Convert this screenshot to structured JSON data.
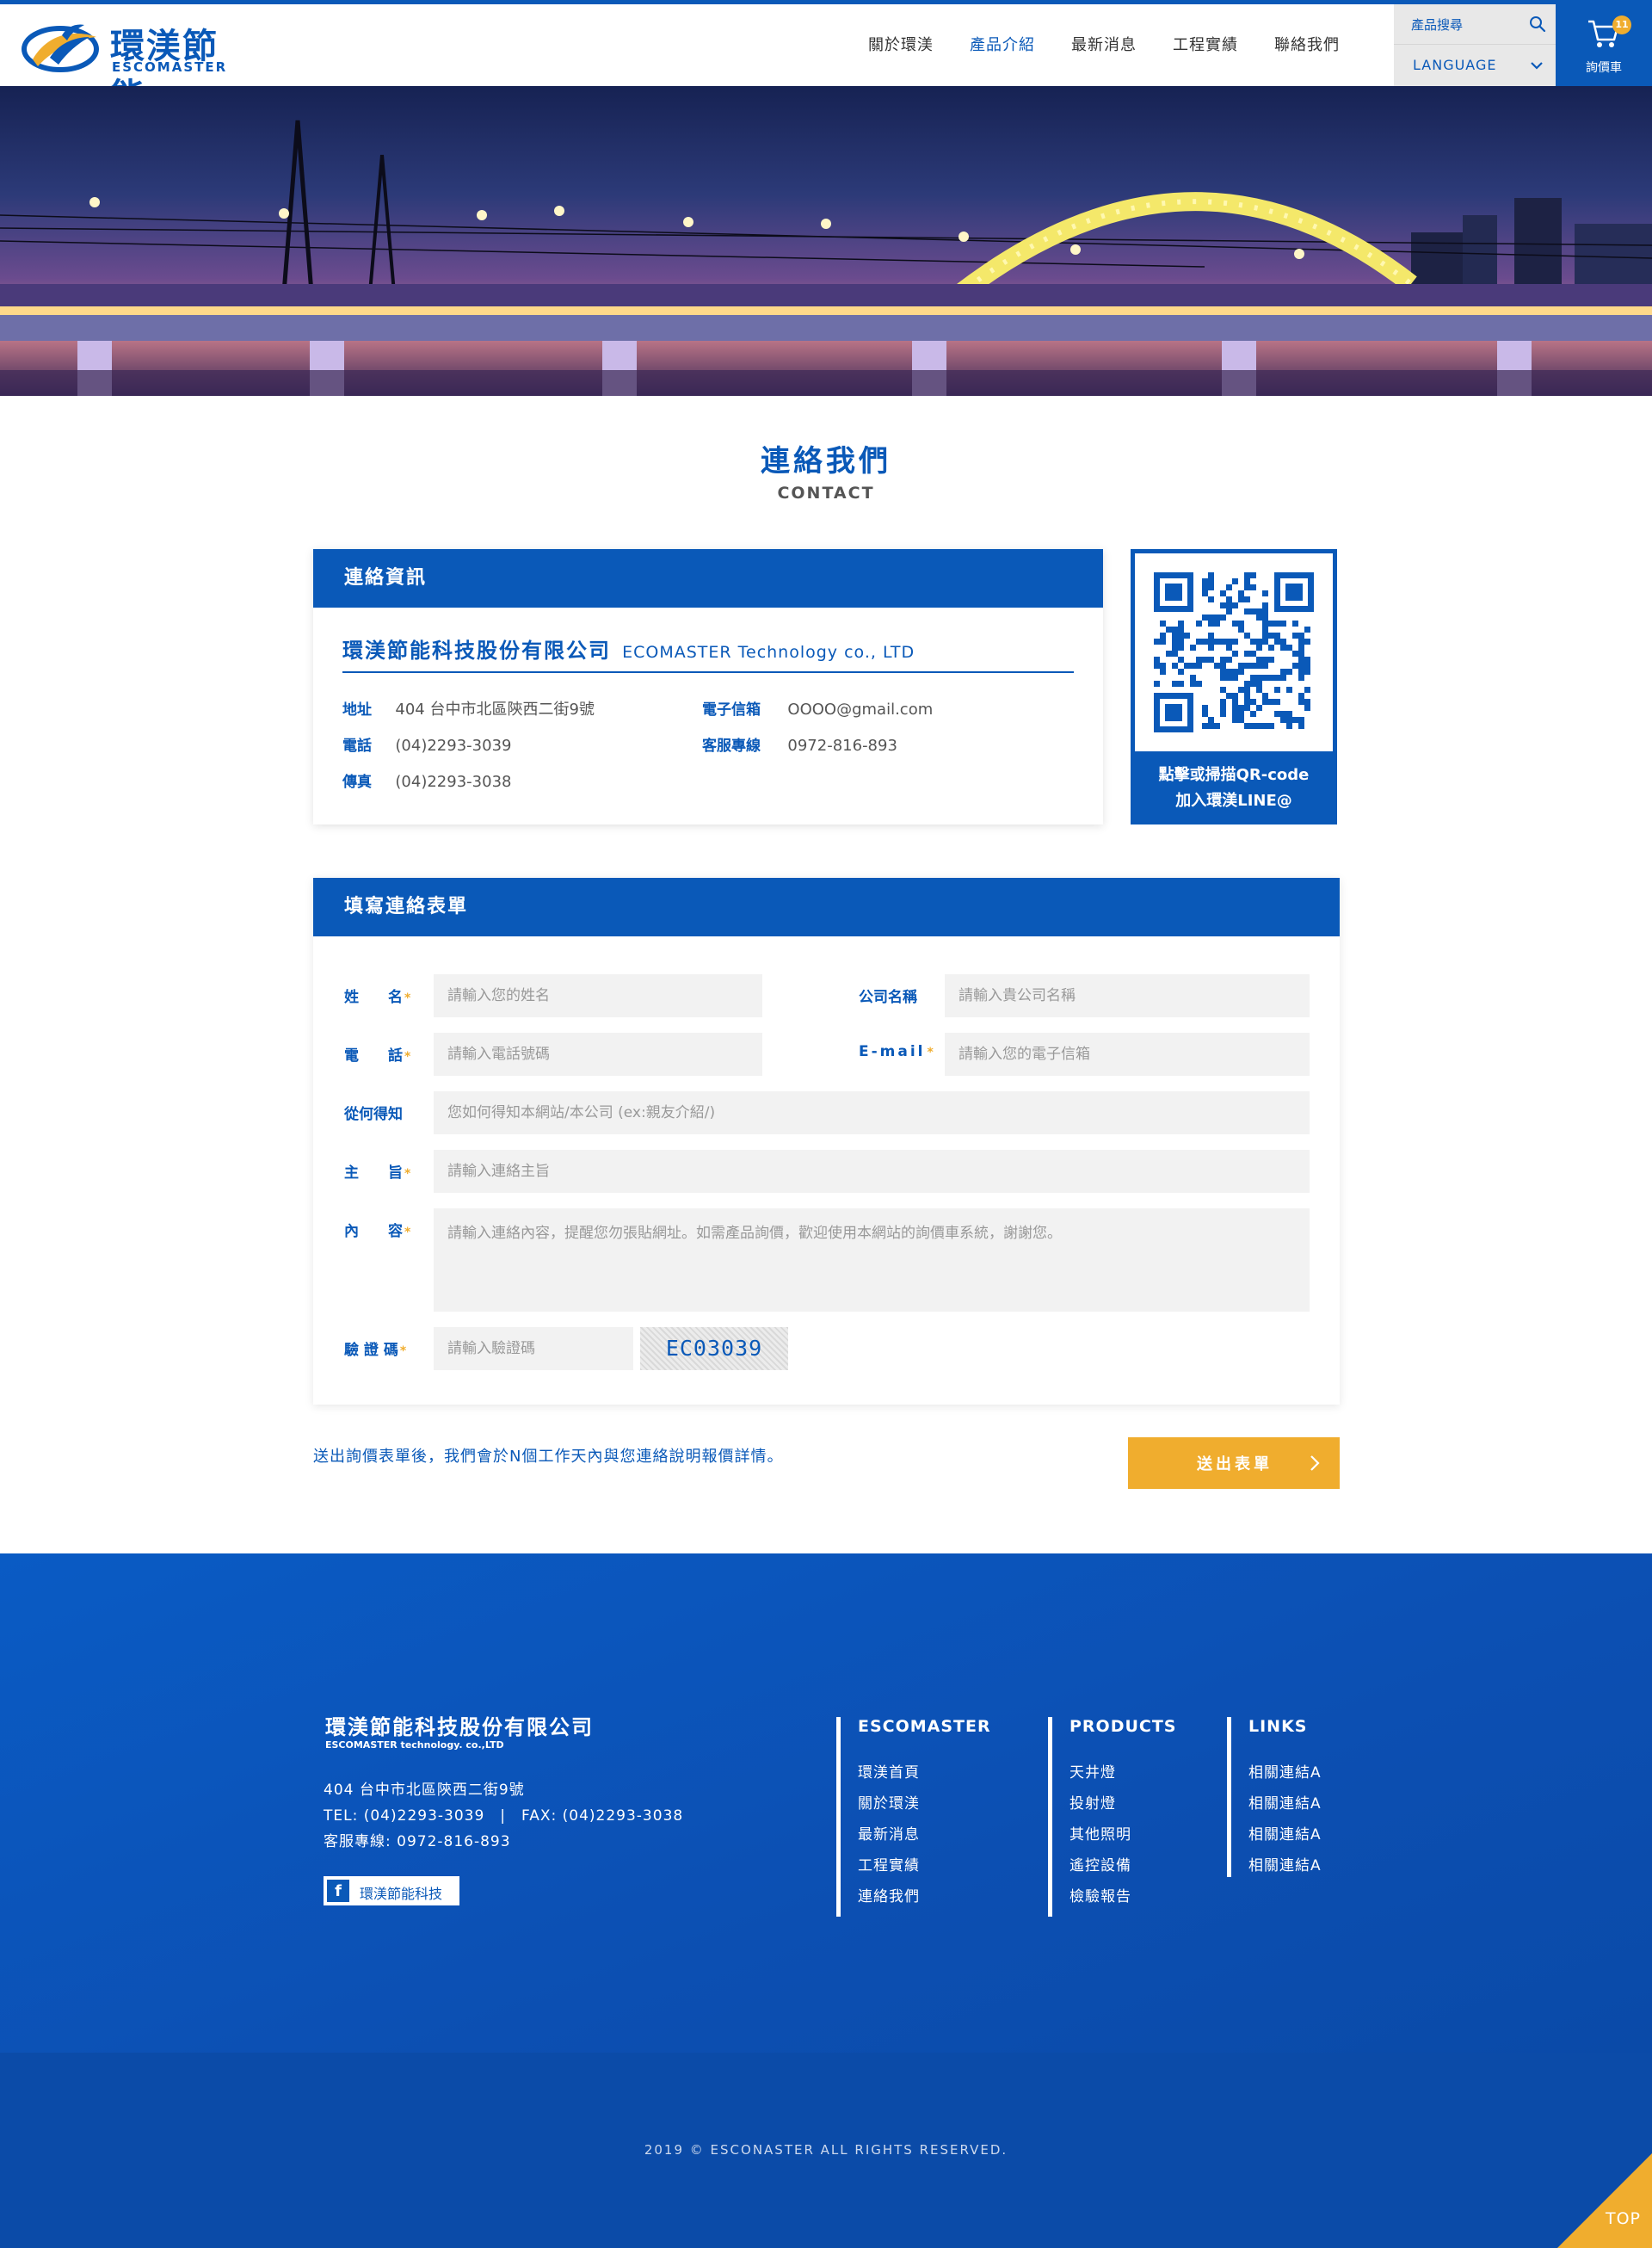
{
  "brand": {
    "name_cn": "環渼節能",
    "name_en": "ESCOMASTER"
  },
  "nav": {
    "items": [
      {
        "label": "關於環渼"
      },
      {
        "label": "產品介紹"
      },
      {
        "label": "最新消息"
      },
      {
        "label": "工程實績"
      },
      {
        "label": "聯絡我們"
      }
    ]
  },
  "header": {
    "search_placeholder": "產品搜尋",
    "language_label": "LANGUAGE",
    "cart_label": "詢價車",
    "cart_count": "11"
  },
  "page": {
    "title": "連絡我們",
    "subtitle": "CONTACT"
  },
  "contact": {
    "heading": "連絡資訊",
    "company_cn": "環渼節能科技股份有限公司",
    "company_en": "ECOMASTER Technology co., LTD",
    "address_label": "地址",
    "address": "404 台中市北區陝西二街9號",
    "phone_label": "電話",
    "phone": "(04)2293-3039",
    "fax_label": "傳真",
    "fax": "(04)2293-3038",
    "email_label": "電子信箱",
    "email": "OOOO@gmail.com",
    "service_label": "客服專線",
    "service": "0972-816-893"
  },
  "qr": {
    "line1": "點擊或掃描QR-code",
    "line2": "加入環渼LINE@"
  },
  "form": {
    "heading": "填寫連絡表單",
    "name_label": "姓　　名",
    "name_placeholder": "請輸入您的姓名",
    "company_label": "公司名稱",
    "company_placeholder": "請輸入貴公司名稱",
    "phone_label": "電　　話",
    "phone_placeholder": "請輸入電話號碼",
    "email_label": "E-mail",
    "email_placeholder": "請輸入您的電子信箱",
    "source_label": "從何得知",
    "source_placeholder": "您如何得知本網站/本公司 (ex:親友介紹/)",
    "subject_label": "主　　旨",
    "subject_placeholder": "請輸入連絡主旨",
    "content_label": "內　　容",
    "content_placeholder": "請輸入連絡內容，提醒您勿張貼網址。如需產品詢價，歡迎使用本網站的詢價車系統，謝謝您。",
    "captcha_label": "驗 證 碼",
    "captcha_placeholder": "請輸入驗證碼",
    "captcha_code": "EC03039",
    "required_mark": "*",
    "note": "送出詢價表單後，我們會於N個工作天內與您連絡說明報價詳情。",
    "submit_label": "送出表單"
  },
  "footer": {
    "company_cn": "環渼節能科技股份有限公司",
    "company_en": "ESCOMASTER technology. co.,LTD",
    "address": "404 台中市北區陝西二街9號",
    "tel_fax": "TEL: (04)2293-3039　|　FAX: (04)2293-3038",
    "service": "客服專線: 0972-816-893",
    "facebook_label": "環渼節能科技",
    "col1": {
      "title": "ESCOMASTER",
      "links": [
        "環渼首頁",
        "關於環渼",
        "最新消息",
        "工程實績",
        "連絡我們"
      ]
    },
    "col2": {
      "title": "PRODUCTS",
      "links": [
        "天井燈",
        "投射燈",
        "其他照明",
        "遙控設備",
        "檢驗報告"
      ]
    },
    "col3": {
      "title": "LINKS",
      "links": [
        "相關連結A",
        "相關連結A",
        "相關連結A",
        "相關連結A"
      ]
    },
    "copyright": "2019 © ESCONASTER ALL RIGHTS RESERVED.",
    "top_label": "TOP"
  },
  "colors": {
    "primary": "#0a59b8",
    "accent": "#f0ad2e",
    "footer_bg": "#0b4ba8"
  }
}
